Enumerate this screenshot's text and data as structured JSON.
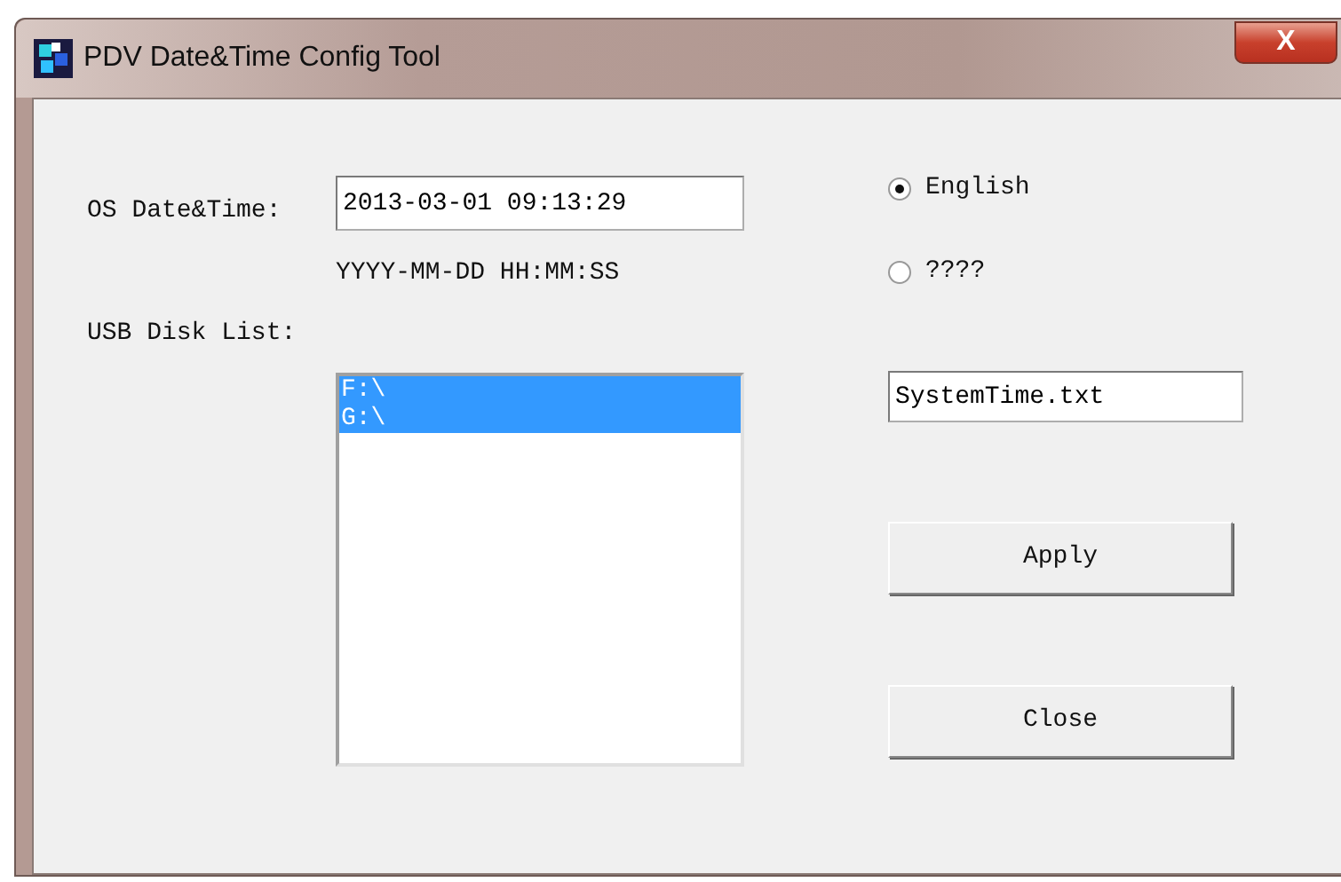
{
  "window": {
    "title": "PDV Date&Time Config Tool",
    "close_label": "X"
  },
  "os_datetime": {
    "label": "OS Date&Time:",
    "value": "2013-03-01 09:13:29",
    "format_hint": "YYYY-MM-DD HH:MM:SS"
  },
  "usb_disk_list": {
    "label": "USB Disk List:",
    "items": [
      {
        "text": "F:\\",
        "selected": true
      },
      {
        "text": "G:\\",
        "selected": true
      }
    ]
  },
  "languages": [
    {
      "label": "English",
      "selected": true
    },
    {
      "label": "????",
      "selected": false
    }
  ],
  "file_name": {
    "value": "SystemTime.txt"
  },
  "buttons": [
    {
      "label": "Apply"
    },
    {
      "label": "Close"
    }
  ]
}
